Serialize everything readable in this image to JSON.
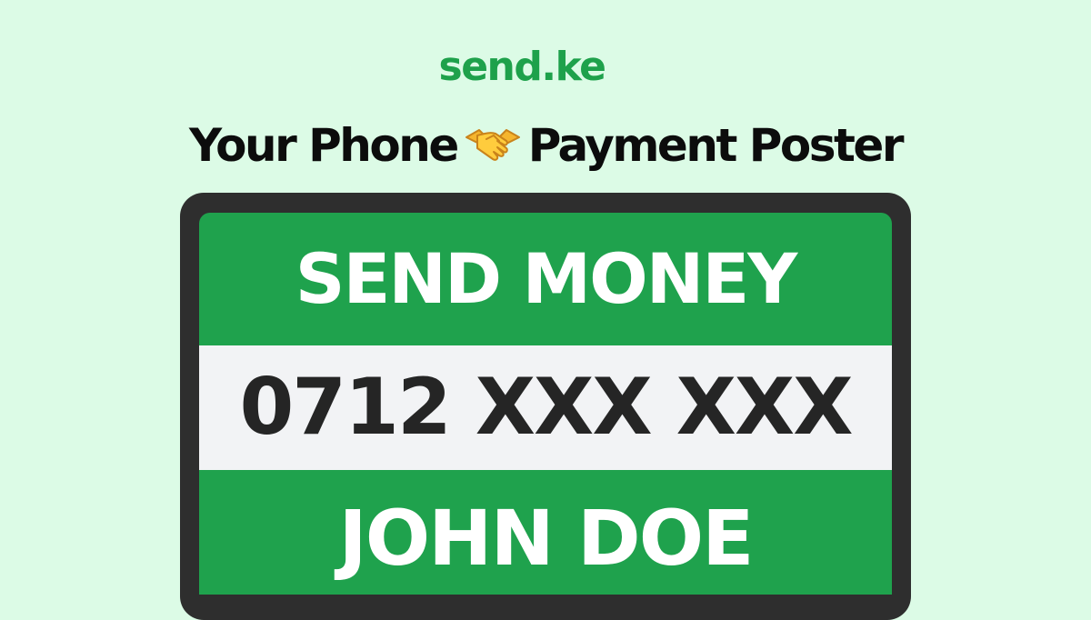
{
  "brand": {
    "name": "send.ke",
    "color": "#1ea14b"
  },
  "headline": {
    "part1": "Your Phone",
    "icon": "handshake-icon",
    "part2": "Payment Poster"
  },
  "poster": {
    "title": "SEND MONEY",
    "phone": "0712 XXX XXX",
    "name": "JOHN DOE",
    "green": "#1fa24d",
    "frame": "#2e2e2e"
  }
}
